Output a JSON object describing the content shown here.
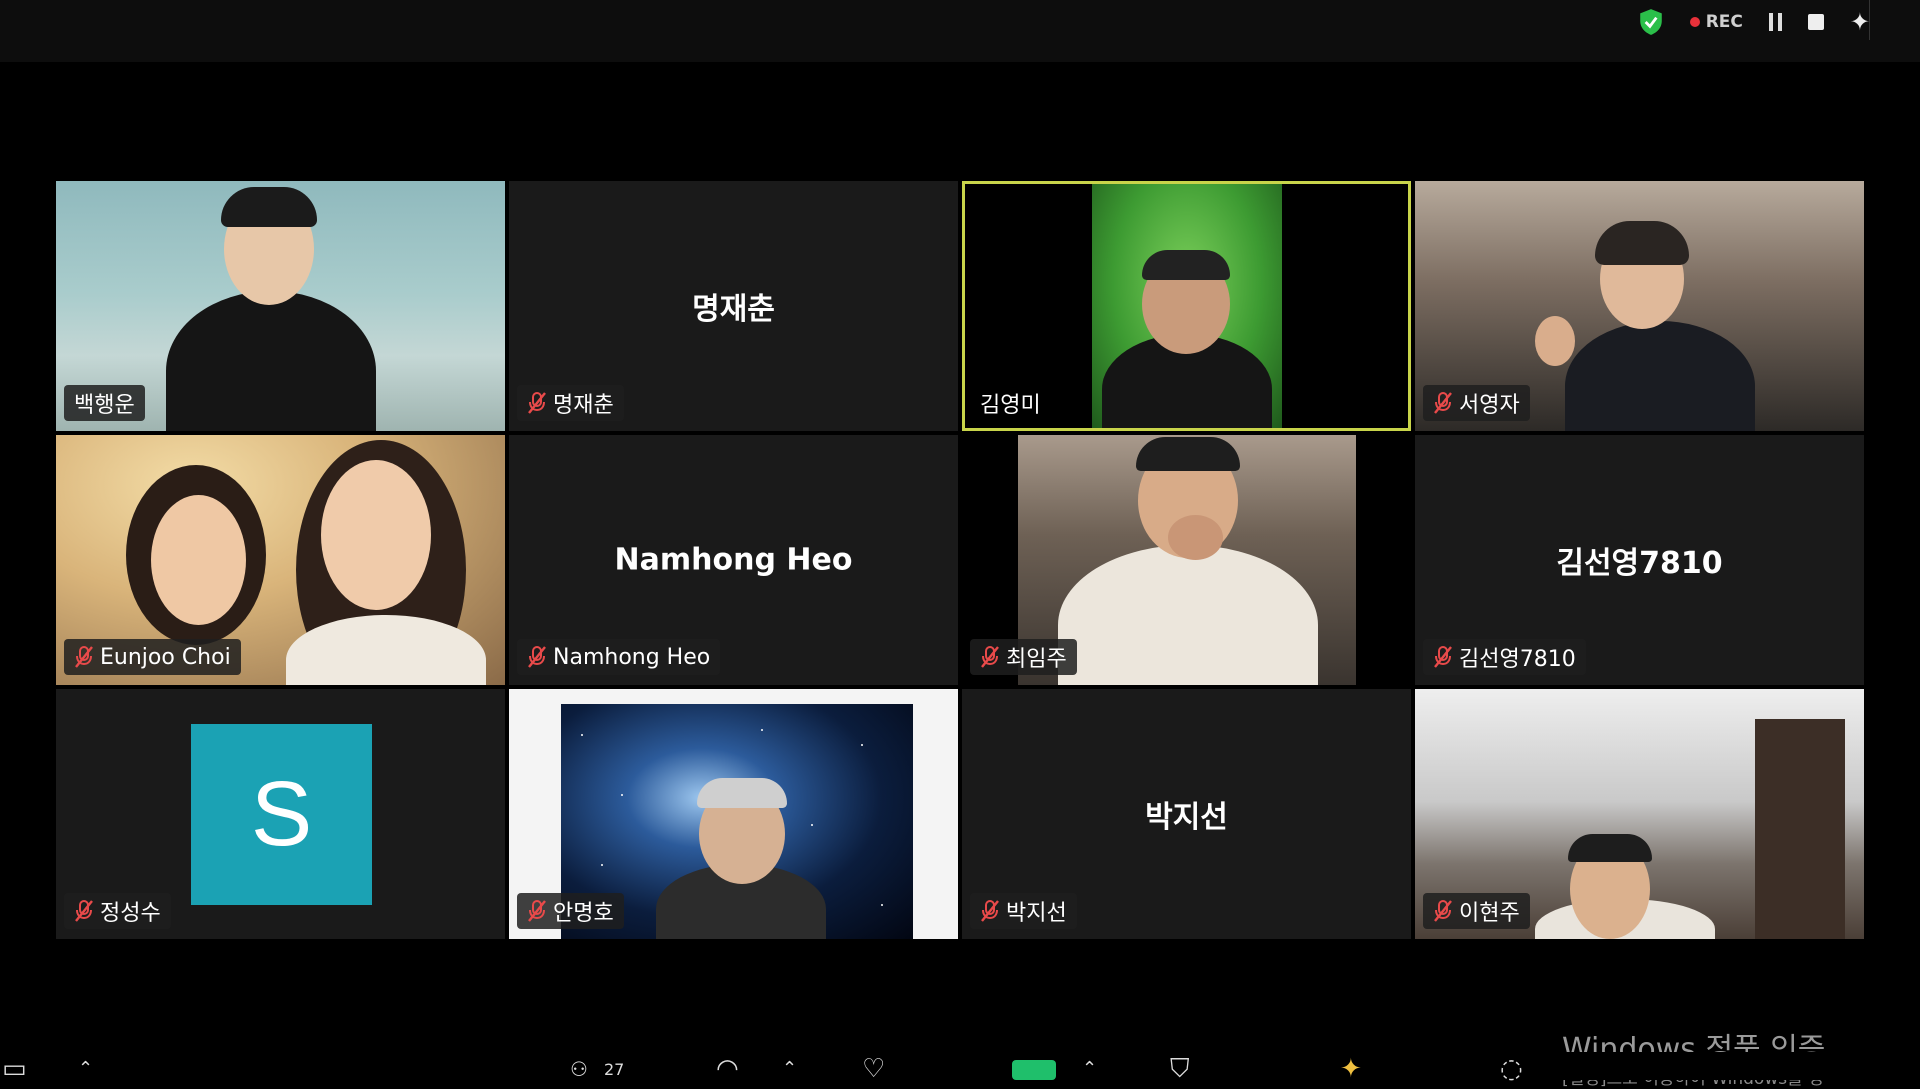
{
  "top_bar": {
    "recording_label": "REC",
    "icons": [
      "shield-check-icon",
      "pause-icon",
      "stop-icon",
      "sparkle-icon"
    ],
    "colors": {
      "shield": "#2bbf4a",
      "rec_dot": "#e8313a"
    }
  },
  "tiles": [
    {
      "id": "t1",
      "name": "백행운",
      "type": "video",
      "muted": false
    },
    {
      "id": "t2",
      "name": "명재춘",
      "center_name": "명재춘",
      "type": "name",
      "muted": true
    },
    {
      "id": "t3",
      "name": "김영미",
      "type": "video",
      "muted": false,
      "active_speaker": true
    },
    {
      "id": "t4",
      "name": "서영자",
      "type": "video",
      "muted": true
    },
    {
      "id": "t5",
      "name": "Eunjoo Choi",
      "type": "video",
      "muted": true
    },
    {
      "id": "t6",
      "name": "Namhong Heo",
      "center_name": "Namhong Heo",
      "type": "name",
      "muted": true
    },
    {
      "id": "t7",
      "name": "최임주",
      "type": "video",
      "muted": true
    },
    {
      "id": "t8",
      "name": "김선영7810",
      "center_name": "김선영7810",
      "type": "name",
      "muted": true
    },
    {
      "id": "t9",
      "name": "정성수",
      "avatar_letter": "S",
      "type": "avatar",
      "muted": true
    },
    {
      "id": "t10",
      "name": "안명호",
      "type": "video",
      "muted": true
    },
    {
      "id": "t11",
      "name": "박지선",
      "center_name": "박지선",
      "type": "name",
      "muted": true
    },
    {
      "id": "t12",
      "name": "이현주",
      "type": "video",
      "muted": true
    }
  ],
  "bottom_bar": {
    "participants_count": "27",
    "icons": [
      "video-off-icon",
      "chevron-up-icon",
      "participants-icon",
      "chat-icon",
      "chevron-up-icon",
      "reactions-icon",
      "share-screen-icon",
      "chevron-up-icon",
      "security-icon",
      "ai-companion-icon",
      "more-icon"
    ]
  },
  "watermark": {
    "title": "Windows 정품 인증",
    "subtitle": "[설정]으로 이동하여 Windows를 정"
  }
}
